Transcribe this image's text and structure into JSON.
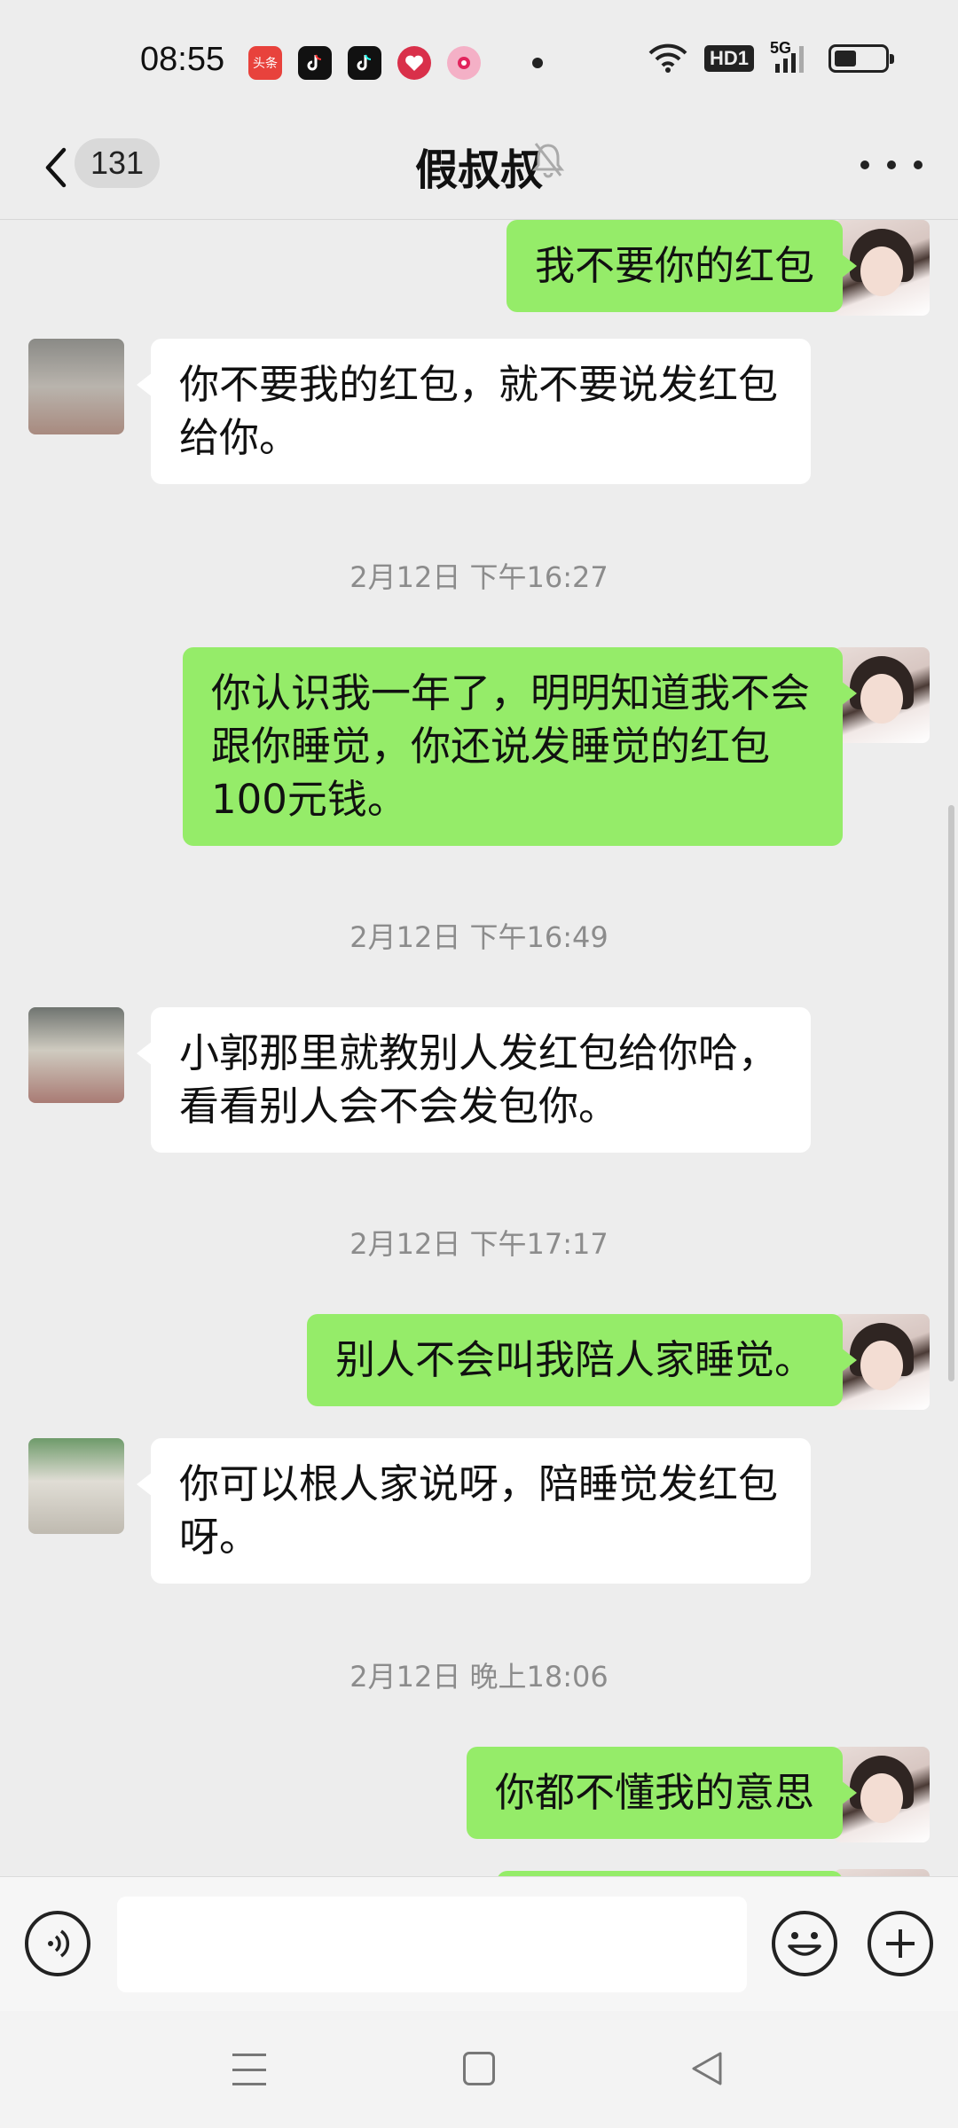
{
  "status_bar": {
    "time": "08:55",
    "apps": [
      {
        "icon": "toutiao-app-icon",
        "label": "头条",
        "color": "#e8423c"
      },
      {
        "icon": "douyin-lite-app-icon",
        "label": "",
        "color": "#111111"
      },
      {
        "icon": "douyin-app-icon",
        "label": "",
        "color": "#111111"
      },
      {
        "icon": "heart-app-icon",
        "label": "",
        "color": "#d9304a"
      },
      {
        "icon": "pink-chat-app-icon",
        "label": "",
        "color": "#f4b0c6"
      }
    ],
    "network": "5G",
    "hd_badge": "HD1",
    "battery_level": 0.45
  },
  "header": {
    "unread_count": "131",
    "title": "假叔叔"
  },
  "messages": [
    {
      "type": "text",
      "sender": "me",
      "text": "我不要你的红包"
    },
    {
      "type": "text",
      "sender": "friend",
      "avatar": "av1",
      "text": "你不要我的红包，就不要说发红包给你。"
    },
    {
      "type": "time",
      "text": "2月12日 下午16:27"
    },
    {
      "type": "text",
      "sender": "me",
      "text": "你认识我一年了，明明知道我不会跟你睡觉，你还说发睡觉的红包100元钱。"
    },
    {
      "type": "time",
      "text": "2月12日 下午16:49"
    },
    {
      "type": "text",
      "sender": "friend",
      "avatar": "av2",
      "text": "小郭那里就教别人发红包给你哈，看看别人会不会发包你。"
    },
    {
      "type": "time",
      "text": "2月12日 下午17:17"
    },
    {
      "type": "text",
      "sender": "me",
      "text": "别人不会叫我陪人家睡觉。"
    },
    {
      "type": "text",
      "sender": "friend",
      "avatar": "av3",
      "text": "你可以根人家说呀，陪睡觉发红包呀。"
    },
    {
      "type": "time",
      "text": "2月12日 晚上18:06"
    },
    {
      "type": "text",
      "sender": "me",
      "text": "你都不懂我的意思"
    }
  ],
  "input": {
    "value": "",
    "placeholder": ""
  }
}
